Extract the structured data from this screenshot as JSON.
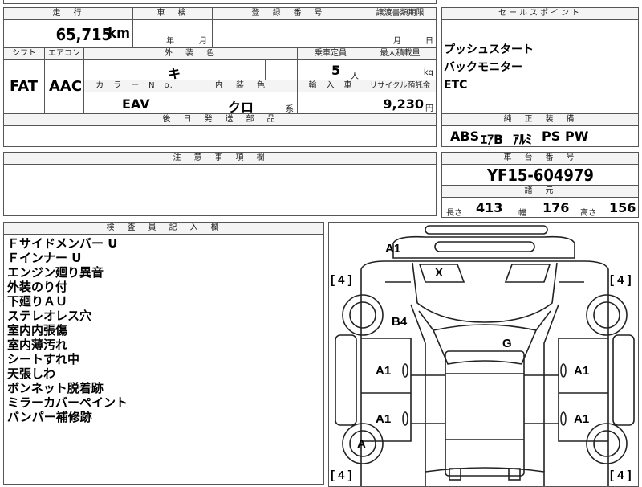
{
  "header": {
    "mileage_label": "走　行",
    "shaken_label": "車　検",
    "reg_label": "登　録　番　号",
    "transfer_label": "譲渡書類期限",
    "sales_label": "セールスポイント"
  },
  "row1": {
    "mileage_value": "65,715",
    "mileage_unit": "km",
    "year_unit": "年",
    "month_unit": "月",
    "transfer_month_unit": "月",
    "transfer_day_unit": "日"
  },
  "row2_labels": {
    "shift": "シフト",
    "aircon": "エアコン",
    "exterior_color": "外　装　色",
    "capacity": "乗車定員",
    "max_load": "最大積載量"
  },
  "row2_values": {
    "shift": "FAT",
    "aircon": "AAC",
    "exterior_color": "キ",
    "capacity": "5",
    "capacity_unit": "人",
    "max_load_unit": "kg"
  },
  "row3_labels": {
    "color_no": "カ　ラ　ー　N　o.",
    "interior_color": "内　装　色",
    "import": "輸　入　車",
    "recycle": "リサイクル預託金"
  },
  "row3_values": {
    "color_no": "EAV",
    "interior_color": "クロ",
    "interior_suffix": "系",
    "recycle_fee": "9,230",
    "recycle_unit": "円"
  },
  "later_parts_label": "後　日　発　送　部　品",
  "sales_points": [
    "プッシュスタート",
    "バックモニター",
    "ETC"
  ],
  "standard_equipment": {
    "label": "純　正　装　備",
    "items": [
      "ABS",
      "ｴｱB",
      "ｱﾙﾐ",
      "PS",
      "PW"
    ]
  },
  "notes_label": "注　意　事　項　欄",
  "chassis": {
    "label": "車　台　番　号",
    "number": "YF15-604979"
  },
  "specs": {
    "label": "諸　元",
    "length_label": "長さ",
    "length": "413",
    "width_label": "幅",
    "width": "176",
    "height_label": "高さ",
    "height": "156"
  },
  "inspector": {
    "label": "検　査　員　記　入　欄",
    "items": [
      "Ｆサイドメンバー U",
      "Ｆインナー U",
      "エンジン廻り異音",
      "外装のり付",
      "下廻りＡＵ",
      "ステレオレス穴",
      "室内内張傷",
      "室内薄汚れ",
      "シートすれ中",
      "天張しわ",
      "ボンネット脱着跡",
      "ミラーカバーペイント",
      "バンパー補修跡"
    ]
  },
  "diagram": {
    "marks": {
      "front_bumper": "A1",
      "bonnet": "X",
      "left_front_fender": "B4",
      "windshield": "G",
      "left_front_door": "A1",
      "right_front_door": "A1",
      "left_rear_door": "A1",
      "right_rear_door": "A1",
      "left_rear_wheel": "A"
    },
    "tires": {
      "front_left": "4",
      "front_right": "4",
      "rear_left": "4",
      "rear_right": "4"
    }
  }
}
